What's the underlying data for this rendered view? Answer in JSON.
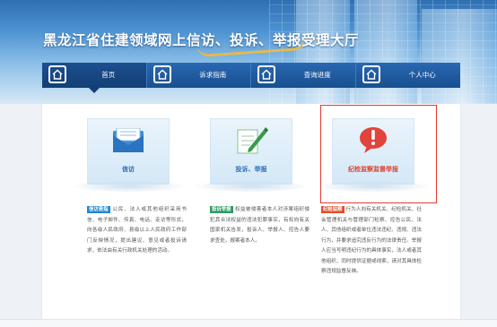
{
  "header": {
    "site_title": "黑龙江省住建领域网上信访、投诉、举报受理大厅"
  },
  "nav": {
    "items": [
      {
        "label": "首页",
        "icon": "home-icon",
        "active": true
      },
      {
        "label": "诉求指南",
        "icon": "home-icon",
        "active": false
      },
      {
        "label": "查询进度",
        "icon": "home-icon",
        "active": false
      },
      {
        "label": "个人中心",
        "icon": "home-icon",
        "active": false
      }
    ]
  },
  "cards": [
    {
      "caption": "信访",
      "icon": "envelope-icon",
      "tag": "信访是指",
      "description": "公民、法人或其他组织采用书信、电子邮件、传真、电话、走访等形式，向各级人民政府、县级以上人民政府工作部门反映情况，提出建议、意见或者投诉请求，依法由有关行政机关处理的活动。"
    },
    {
      "caption": "投诉、举报",
      "icon": "pen-paper-icon",
      "tag": "投诉举报",
      "description": "权益被侵害者本人对涉案组织侵犯其合法权益的违法犯罪事实，有权向有关国家机关告发，投诉人、举报人、控告人要求查处，报案者本人。"
    },
    {
      "caption": "纪检监察监督举报",
      "icon": "alert-bubble-icon",
      "tag": "纪检监察",
      "description": "行为人向有关机关、纪检机关、社会管理机关与管理部门检察、控告公民、法人、其他组织或者单位违法违纪、违规、违法行为，并要求追究违反行为的法律责任。举报人应当写明违纪行为的具体事实，法人或者其他组织，同时提供证据或线索，请对其具体检察违规监督反映。"
    }
  ],
  "colors": {
    "nav_bg": "#18508f",
    "accent_blue": "#2b6cb5",
    "accent_red": "#e0412b",
    "highlight_border": "#e33b34"
  }
}
